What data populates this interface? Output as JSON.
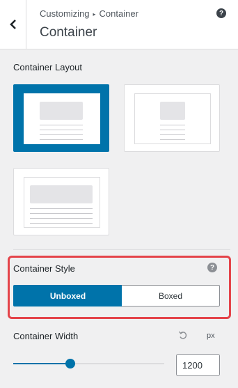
{
  "header": {
    "breadcrumb_parent": "Customizing",
    "breadcrumb_separator": "▸",
    "breadcrumb_current": "Container",
    "title": "Container",
    "back_icon": "chevron-left-icon",
    "help_icon": "question-circle-icon"
  },
  "container_layout": {
    "label": "Container Layout",
    "options": [
      {
        "name": "full-width-contained",
        "selected": true
      },
      {
        "name": "content-boxed",
        "selected": false
      },
      {
        "name": "full-width-stretched",
        "selected": false
      }
    ]
  },
  "container_style": {
    "label": "Container Style",
    "help_icon": "question-circle-icon",
    "options": [
      "Unboxed",
      "Boxed"
    ],
    "selected": "Unboxed"
  },
  "container_width": {
    "label": "Container Width",
    "reset_icon": "undo-icon",
    "unit": "px",
    "value": "1200",
    "slider_fraction": 0.38
  },
  "colors": {
    "accent": "#0073aa",
    "highlight": "#e4444a"
  }
}
